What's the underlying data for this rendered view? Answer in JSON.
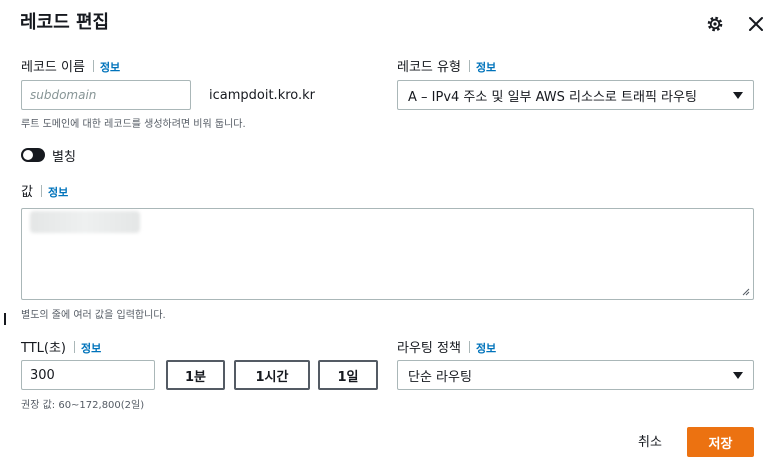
{
  "dialog": {
    "title": "레코드 편집"
  },
  "record_name": {
    "label": "레코드 이름",
    "info": "정보",
    "placeholder": "subdomain",
    "domain_suffix": "icampdoit.kro.kr",
    "hint": "루트 도메인에 대한 레코드를 생성하려면 비워 둡니다."
  },
  "record_type": {
    "label": "레코드 유형",
    "info": "정보",
    "selected": "A – IPv4 주소 및 일부 AWS 리소스로 트래픽 라우팅"
  },
  "alias": {
    "label": "별칭",
    "enabled": false
  },
  "value": {
    "label": "값",
    "info": "정보",
    "hint": "별도의 줄에 여러 값을 입력합니다."
  },
  "ttl": {
    "label": "TTL(초)",
    "info": "정보",
    "value": "300",
    "hint": "권장 값: 60~172,800(2일)",
    "buttons": [
      "1분",
      "1시간",
      "1일"
    ]
  },
  "routing_policy": {
    "label": "라우팅 정책",
    "info": "정보",
    "selected": "단순 라우팅"
  },
  "footer": {
    "cancel": "취소",
    "save": "저장"
  },
  "icons": {
    "settings": "gear-icon",
    "close": "close-icon"
  },
  "colors": {
    "primary": "#ec7211",
    "link": "#0073bb",
    "text": "#16191f",
    "border": "#aab7b8"
  }
}
